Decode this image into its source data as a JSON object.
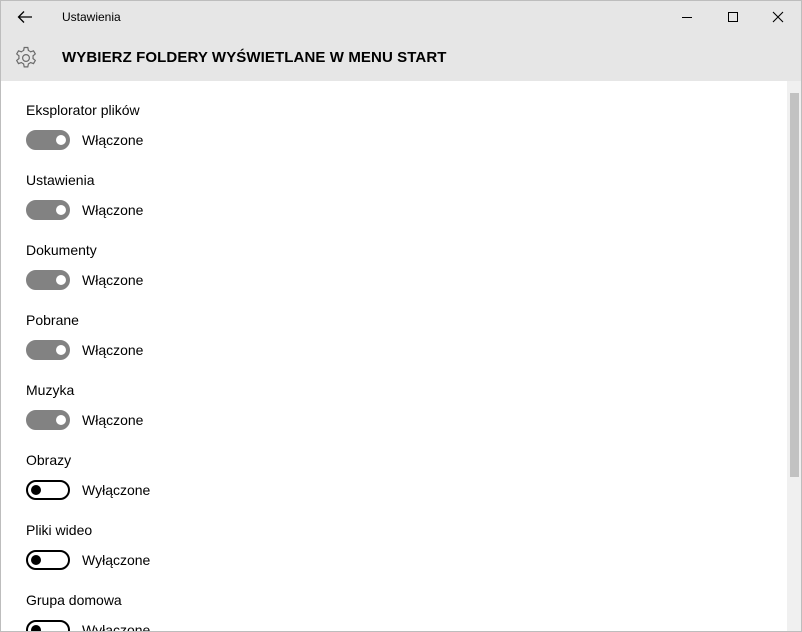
{
  "window": {
    "title": "Ustawienia"
  },
  "header": {
    "title": "WYBIERZ FOLDERY WYŚWIETLANE W MENU START"
  },
  "settings": [
    {
      "label": "Eksplorator plików",
      "state": "on",
      "state_label": "Włączone"
    },
    {
      "label": "Ustawienia",
      "state": "on",
      "state_label": "Włączone"
    },
    {
      "label": "Dokumenty",
      "state": "on",
      "state_label": "Włączone"
    },
    {
      "label": "Pobrane",
      "state": "on",
      "state_label": "Włączone"
    },
    {
      "label": "Muzyka",
      "state": "on",
      "state_label": "Włączone"
    },
    {
      "label": "Obrazy",
      "state": "off",
      "state_label": "Wyłączone"
    },
    {
      "label": "Pliki wideo",
      "state": "off",
      "state_label": "Wyłączone"
    },
    {
      "label": "Grupa domowa",
      "state": "off",
      "state_label": "Wyłączone"
    }
  ],
  "icons": {
    "back": "arrow-left-icon",
    "minimize": "minimize-icon",
    "maximize": "maximize-icon",
    "close": "close-icon",
    "header": "gear-icon"
  },
  "colors": {
    "chrome": "#e6e6e6",
    "toggle_on": "#828282",
    "toggle_off_border": "#000000",
    "scroll_thumb": "#c2c2c2"
  }
}
